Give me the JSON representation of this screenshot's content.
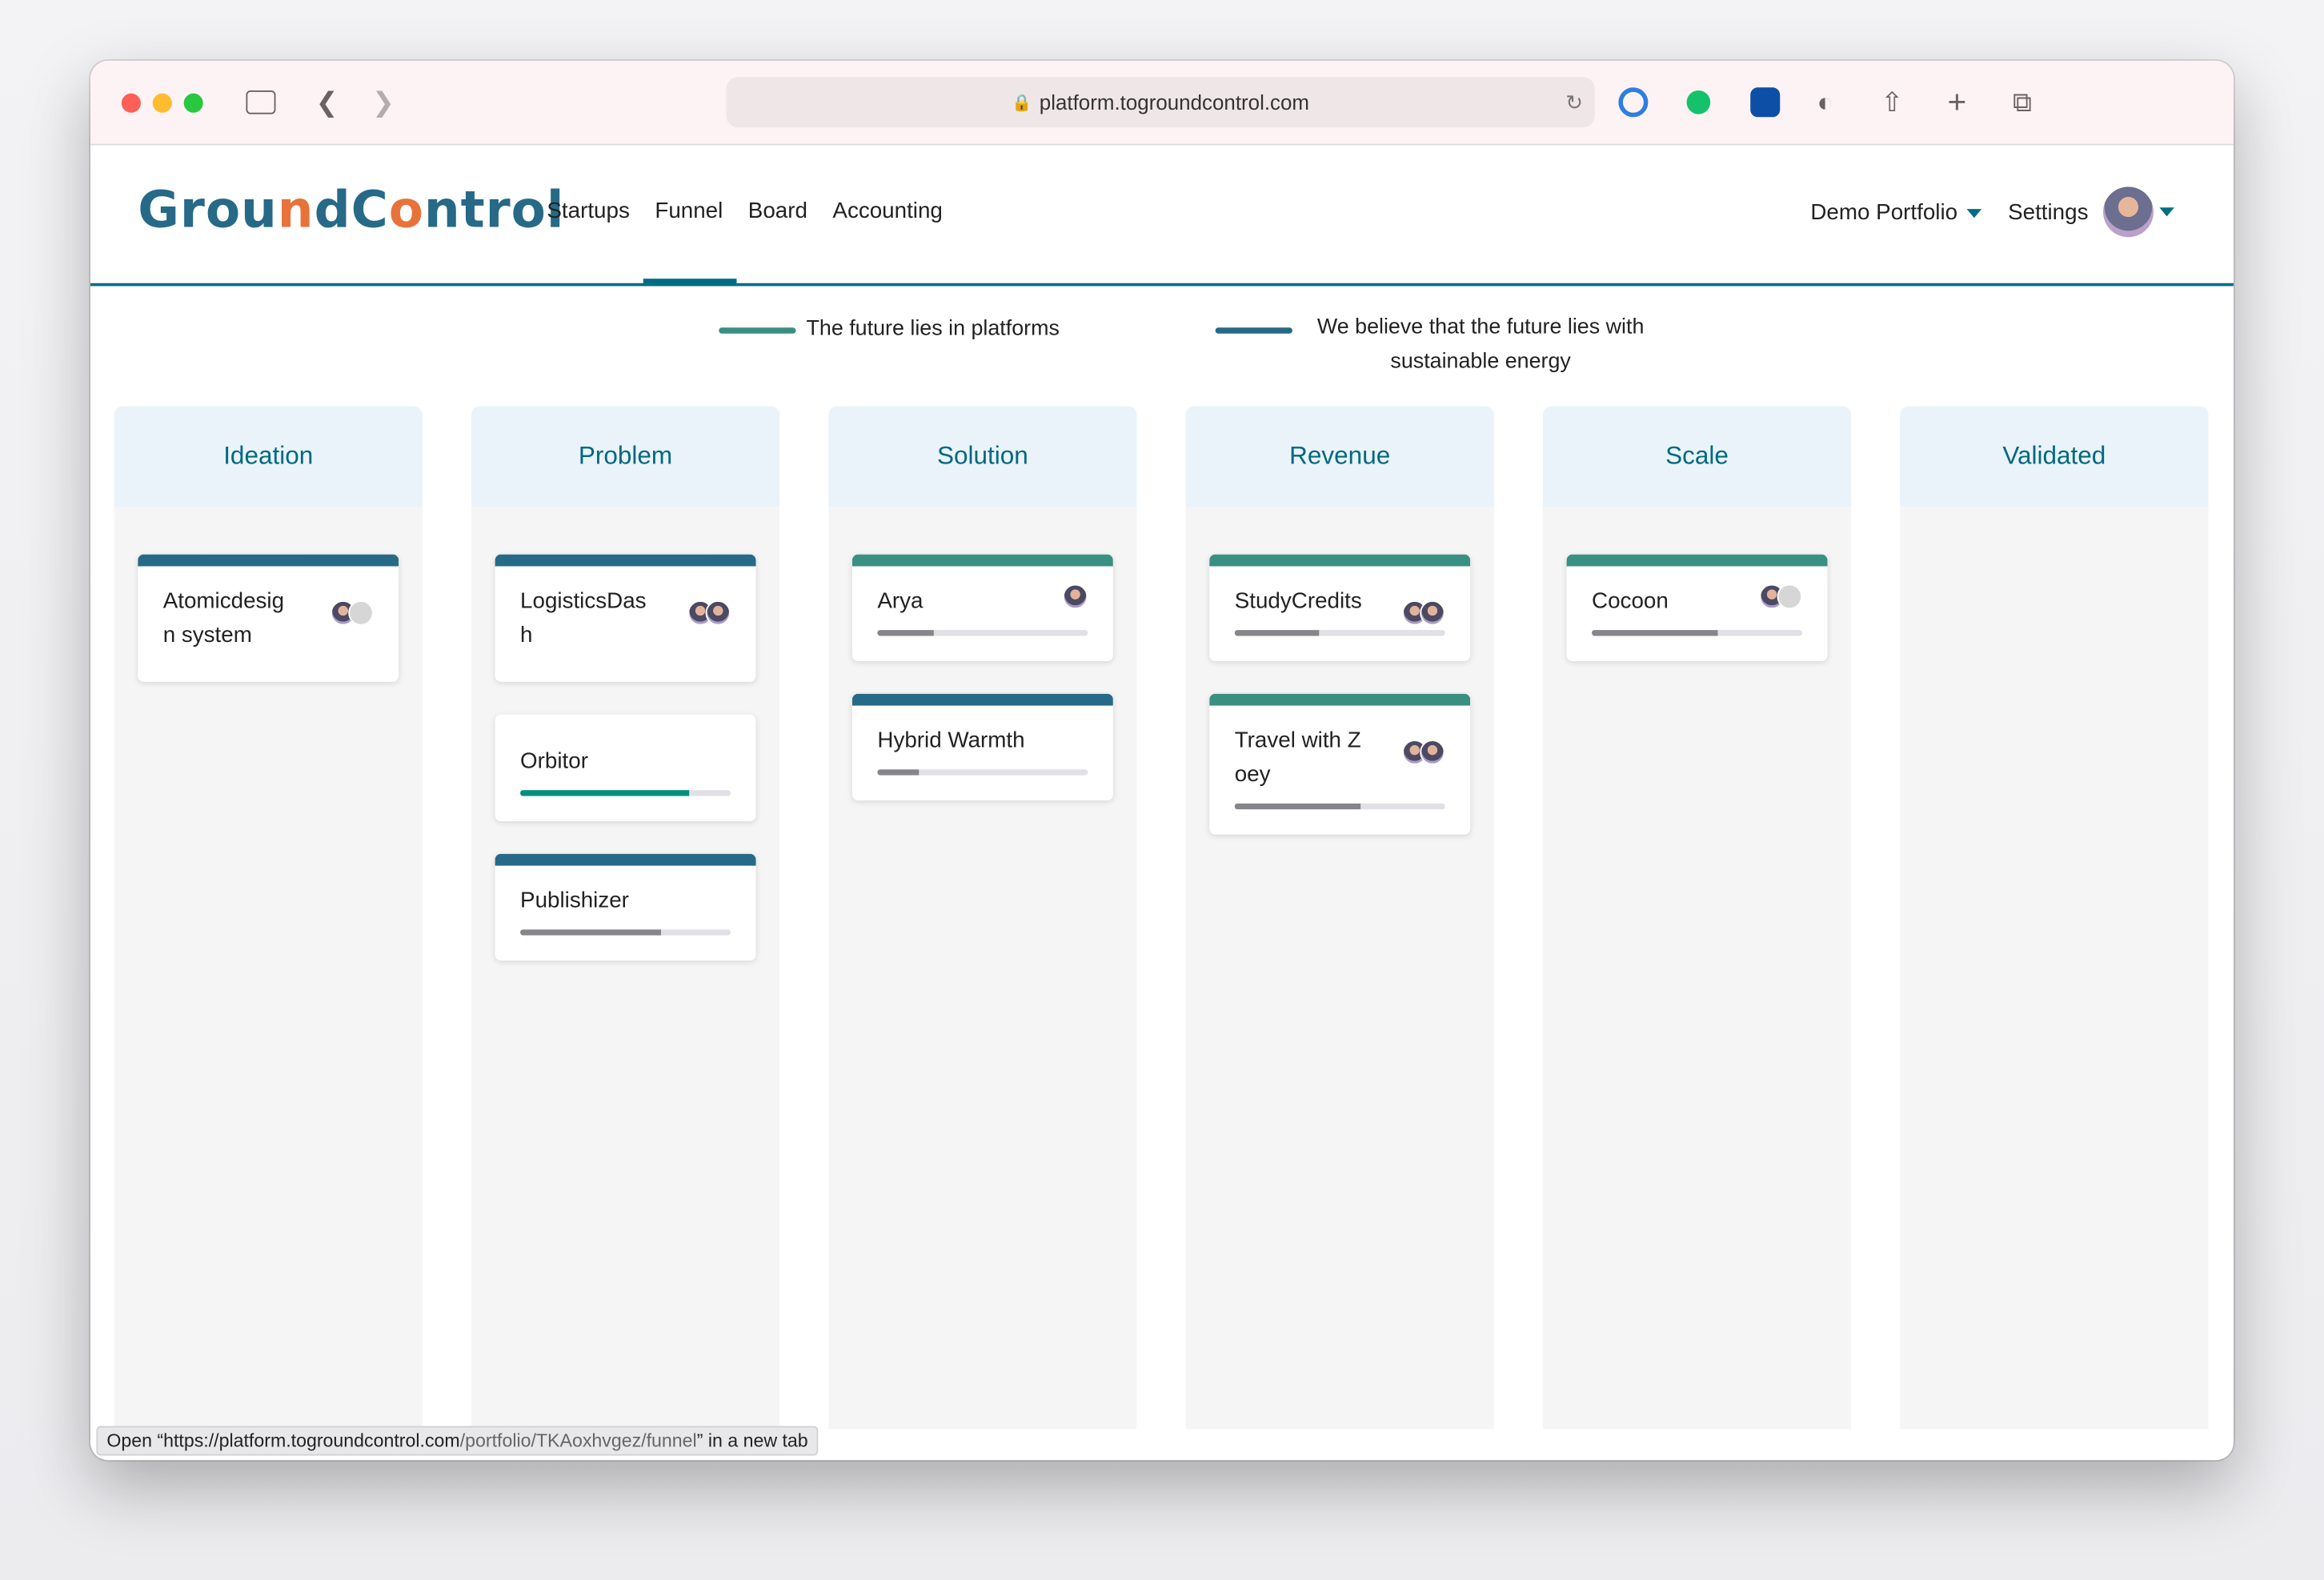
{
  "browser": {
    "url": "platform.togroundcontrol.com",
    "status_prefix": "Open “https://platform.togroundcontrol.com",
    "status_path": "/portfolio/TKAoxhvgez/funnel",
    "status_suffix": "” in a new tab"
  },
  "app": {
    "logo": "GroundControl",
    "nav": [
      "Startups",
      "Funnel",
      "Board",
      "Accounting"
    ],
    "active_nav": "Funnel",
    "portfolio": "Demo Portfolio",
    "settings": "Settings"
  },
  "legend": [
    {
      "label": "The future lies in platforms",
      "color": "#3a9080"
    },
    {
      "label": "We believe that the future lies with sustainable energy",
      "color": "#266a87"
    }
  ],
  "colors": {
    "teal": "#3a9080",
    "blue": "#266a87",
    "progress_gray": "#86858b",
    "progress_teal": "#00907c"
  },
  "columns": [
    {
      "title": "Ideation",
      "cards": [
        {
          "name": "Atomicdesign system",
          "theme": "blue",
          "avatars": [
            "photo",
            "placeholder"
          ]
        }
      ]
    },
    {
      "title": "Problem",
      "cards": [
        {
          "name": "LogisticsDash",
          "theme": "blue",
          "avatars": [
            "photo",
            "photo"
          ]
        },
        {
          "name": "Orbitor",
          "theme": "none",
          "progress": 0.8,
          "progress_color": "teal"
        },
        {
          "name": "Publishizer",
          "theme": "blue",
          "progress": 0.67
        }
      ]
    },
    {
      "title": "Solution",
      "cards": [
        {
          "name": "Arya",
          "theme": "teal",
          "avatars": [
            "photo"
          ],
          "progress": 0.27
        },
        {
          "name": "Hybrid Warmth",
          "theme": "blue",
          "progress": 0.2
        }
      ]
    },
    {
      "title": "Revenue",
      "cards": [
        {
          "name": "StudyCredits",
          "theme": "teal",
          "avatars": [
            "photo",
            "photo"
          ],
          "progress": 0.4
        },
        {
          "name": "Travel with Zoey",
          "theme": "teal",
          "avatars": [
            "photo",
            "photo"
          ],
          "progress": 0.6
        }
      ]
    },
    {
      "title": "Scale",
      "cards": [
        {
          "name": "Cocoon",
          "theme": "teal",
          "avatars": [
            "photo",
            "placeholder"
          ],
          "progress": 0.6
        }
      ]
    },
    {
      "title": "Validated",
      "cards": []
    }
  ]
}
